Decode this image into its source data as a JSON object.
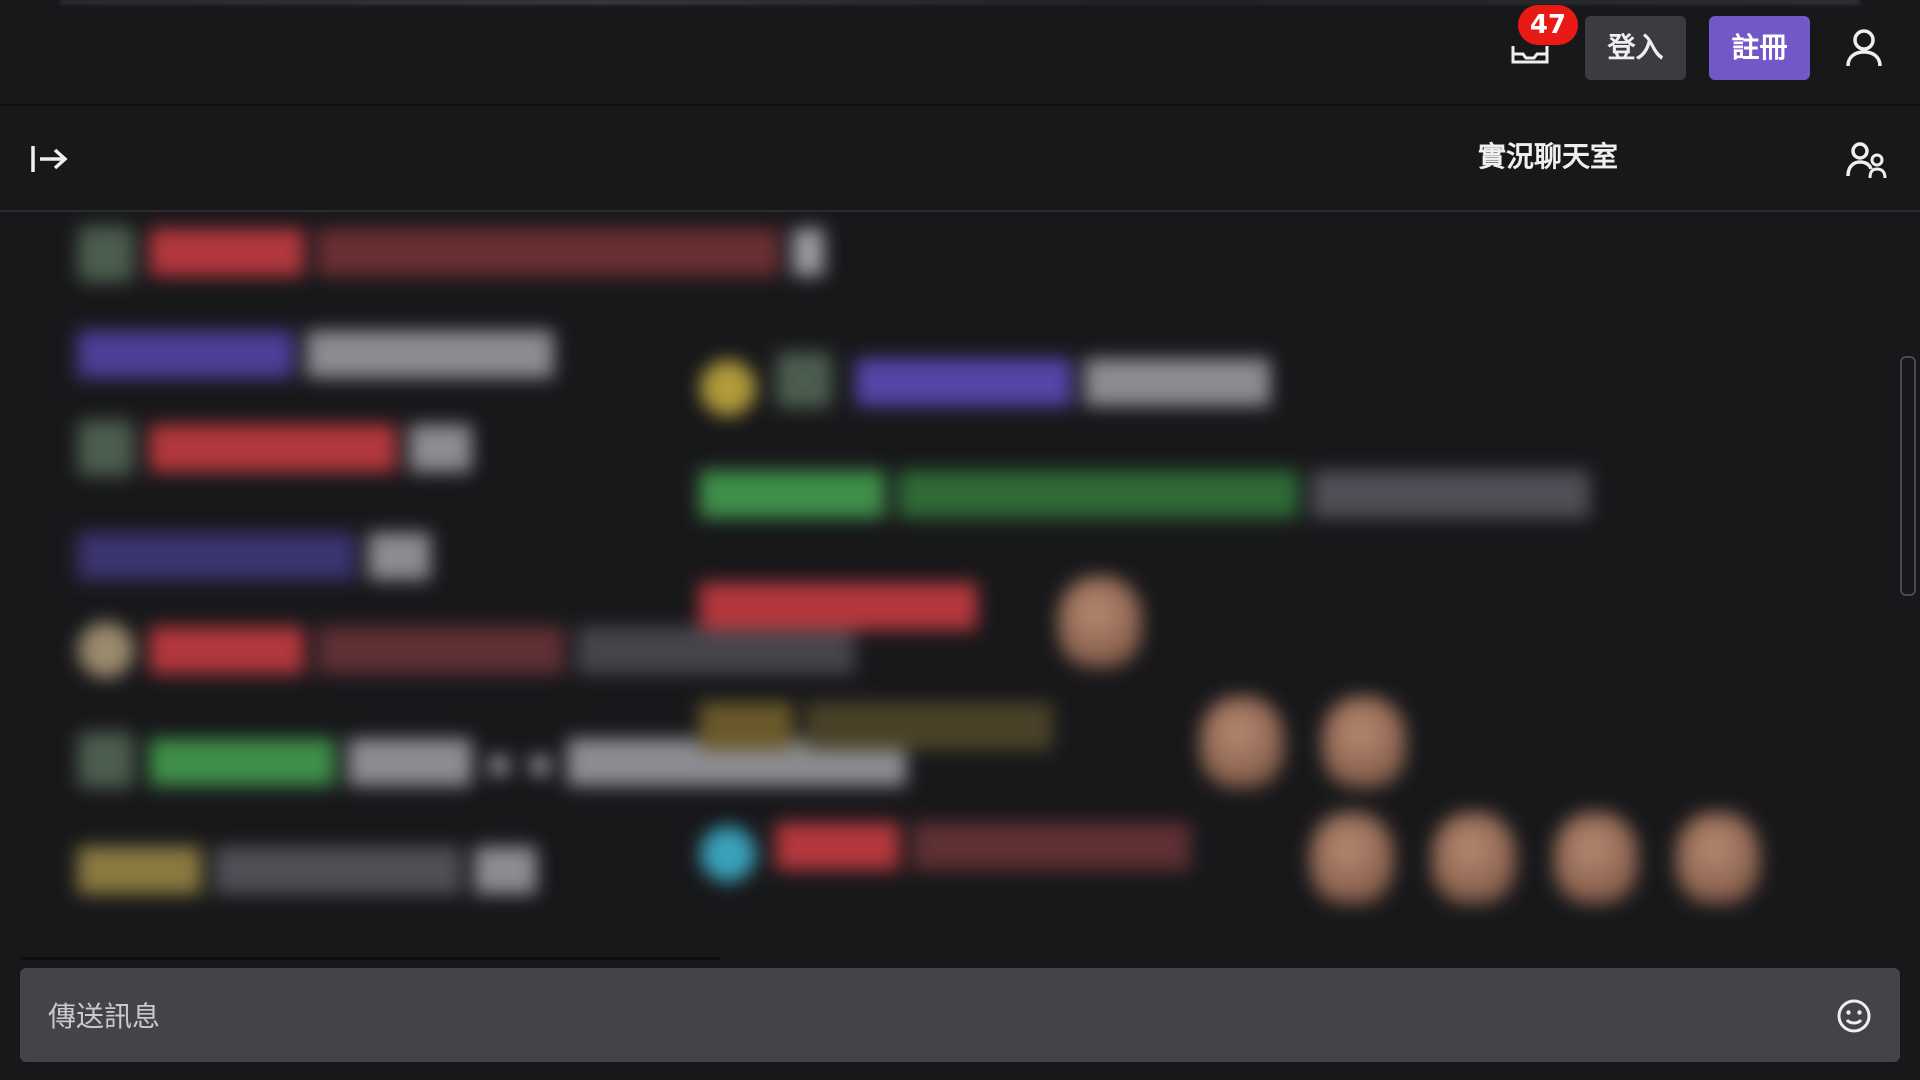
{
  "topbar": {
    "inbox_icon": "inbox-icon",
    "notification_count": "47",
    "login_label": "登入",
    "signup_label": "註冊",
    "user_icon": "user-icon",
    "colors": {
      "badge": "#e91916",
      "signup": "#7356c8",
      "login": "#3b3b41"
    }
  },
  "chat": {
    "collapse_icon": "collapse-arrow-icon",
    "title": "實況聊天室",
    "users_icon": "community-users-icon",
    "composer_placeholder": "傳送訊息",
    "emoji_icon": "emoji-smile-icon",
    "message_colors": [
      "#b3383d",
      "#5446a8",
      "#3f8f4a",
      "#8a7a40",
      "#3aa0b8"
    ]
  }
}
